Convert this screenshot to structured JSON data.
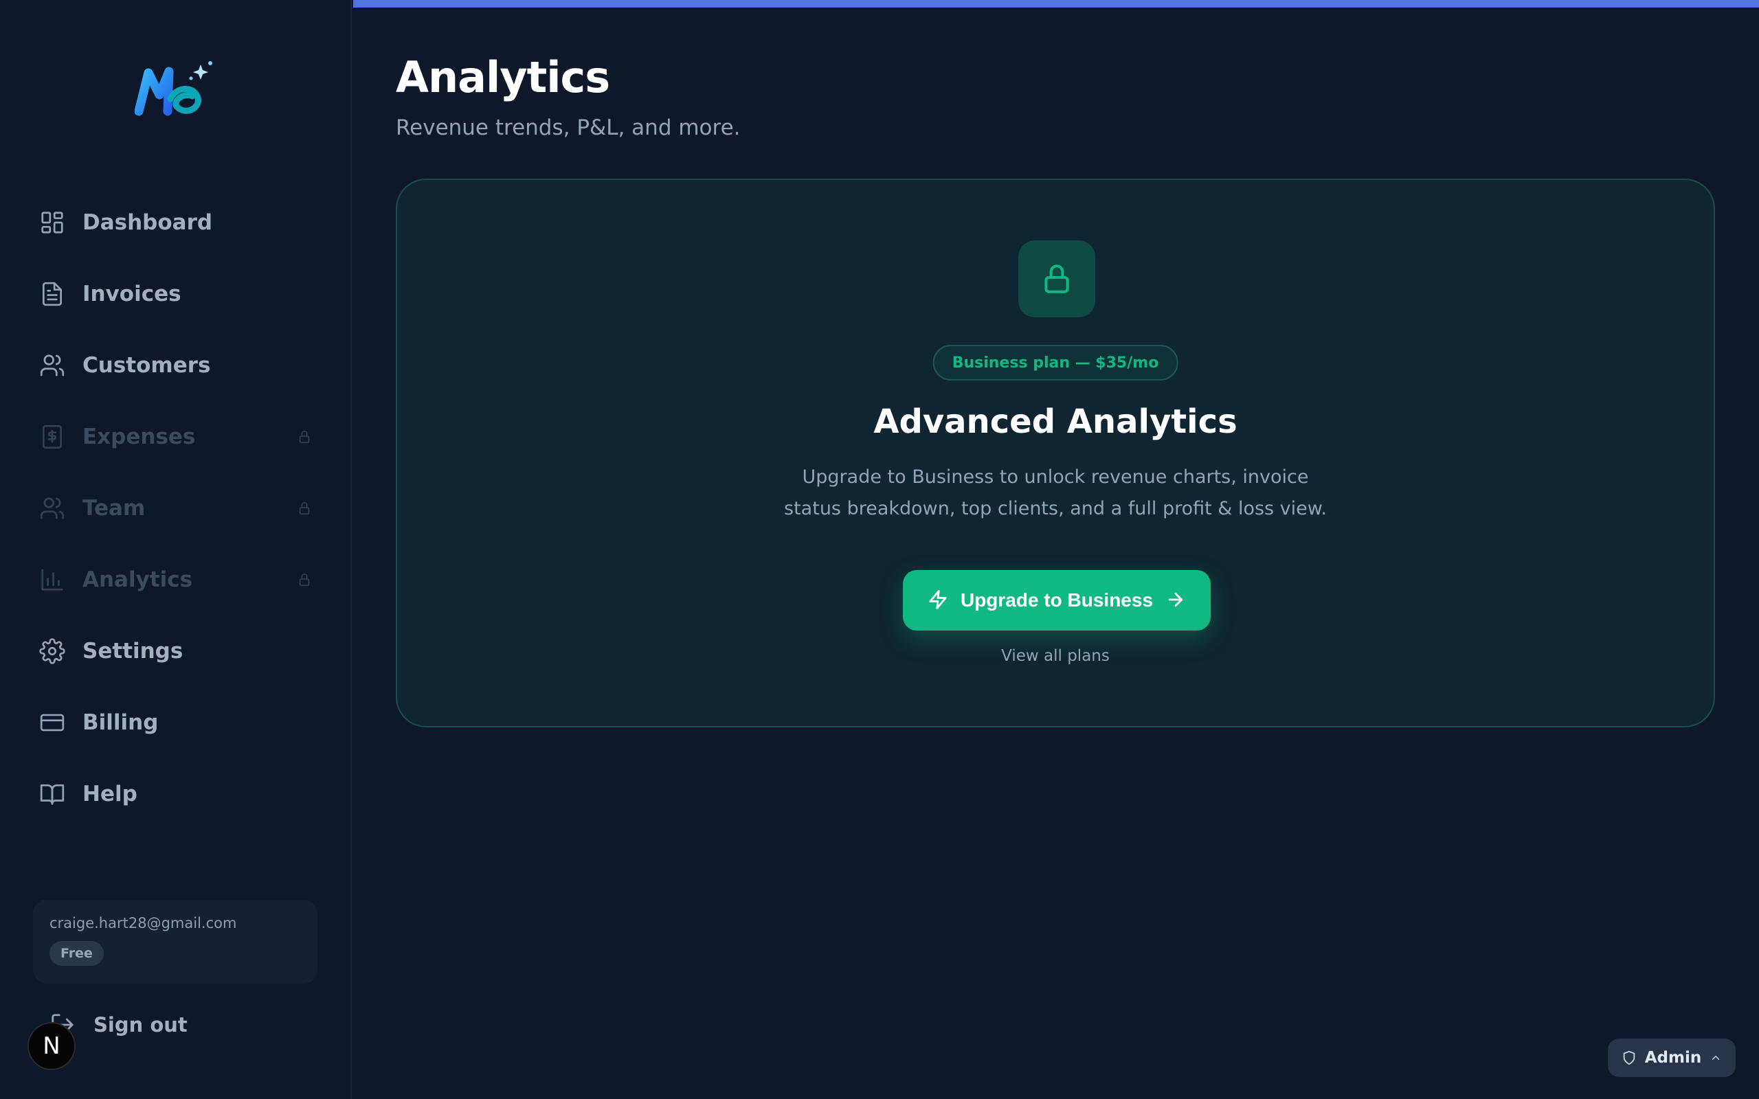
{
  "page": {
    "title": "Analytics",
    "subtitle": "Revenue trends, P&L, and more."
  },
  "colors": {
    "background": "#0f172a",
    "accent": "#10b981",
    "progress_bar": "#5174e0"
  },
  "sidebar": {
    "logo_icon": "app-logo",
    "items": [
      {
        "label": "Dashboard",
        "icon": "dashboard-icon",
        "locked": false
      },
      {
        "label": "Invoices",
        "icon": "file-text-icon",
        "locked": false
      },
      {
        "label": "Customers",
        "icon": "users-icon",
        "locked": false
      },
      {
        "label": "Expenses",
        "icon": "receipt-dollar-icon",
        "locked": true
      },
      {
        "label": "Team",
        "icon": "users-icon",
        "locked": true
      },
      {
        "label": "Analytics",
        "icon": "bar-chart-icon",
        "locked": true
      },
      {
        "label": "Settings",
        "icon": "gear-icon",
        "locked": false
      },
      {
        "label": "Billing",
        "icon": "credit-card-icon",
        "locked": false
      },
      {
        "label": "Help",
        "icon": "book-open-icon",
        "locked": false
      }
    ],
    "user": {
      "email": "craige.hart28@gmail.com",
      "plan": "Free"
    },
    "signout_label": "Sign out"
  },
  "upgrade_card": {
    "icon": "lock-icon",
    "plan_pill": "Business plan — $35/mo",
    "title": "Advanced Analytics",
    "description": "Upgrade to Business to unlock revenue charts, invoice status breakdown, top clients, and a full profit & loss view.",
    "button_label": "Upgrade to Business",
    "view_plans_label": "View all plans"
  },
  "dev_badge": {
    "letter": "N"
  },
  "admin": {
    "label": "Admin"
  }
}
